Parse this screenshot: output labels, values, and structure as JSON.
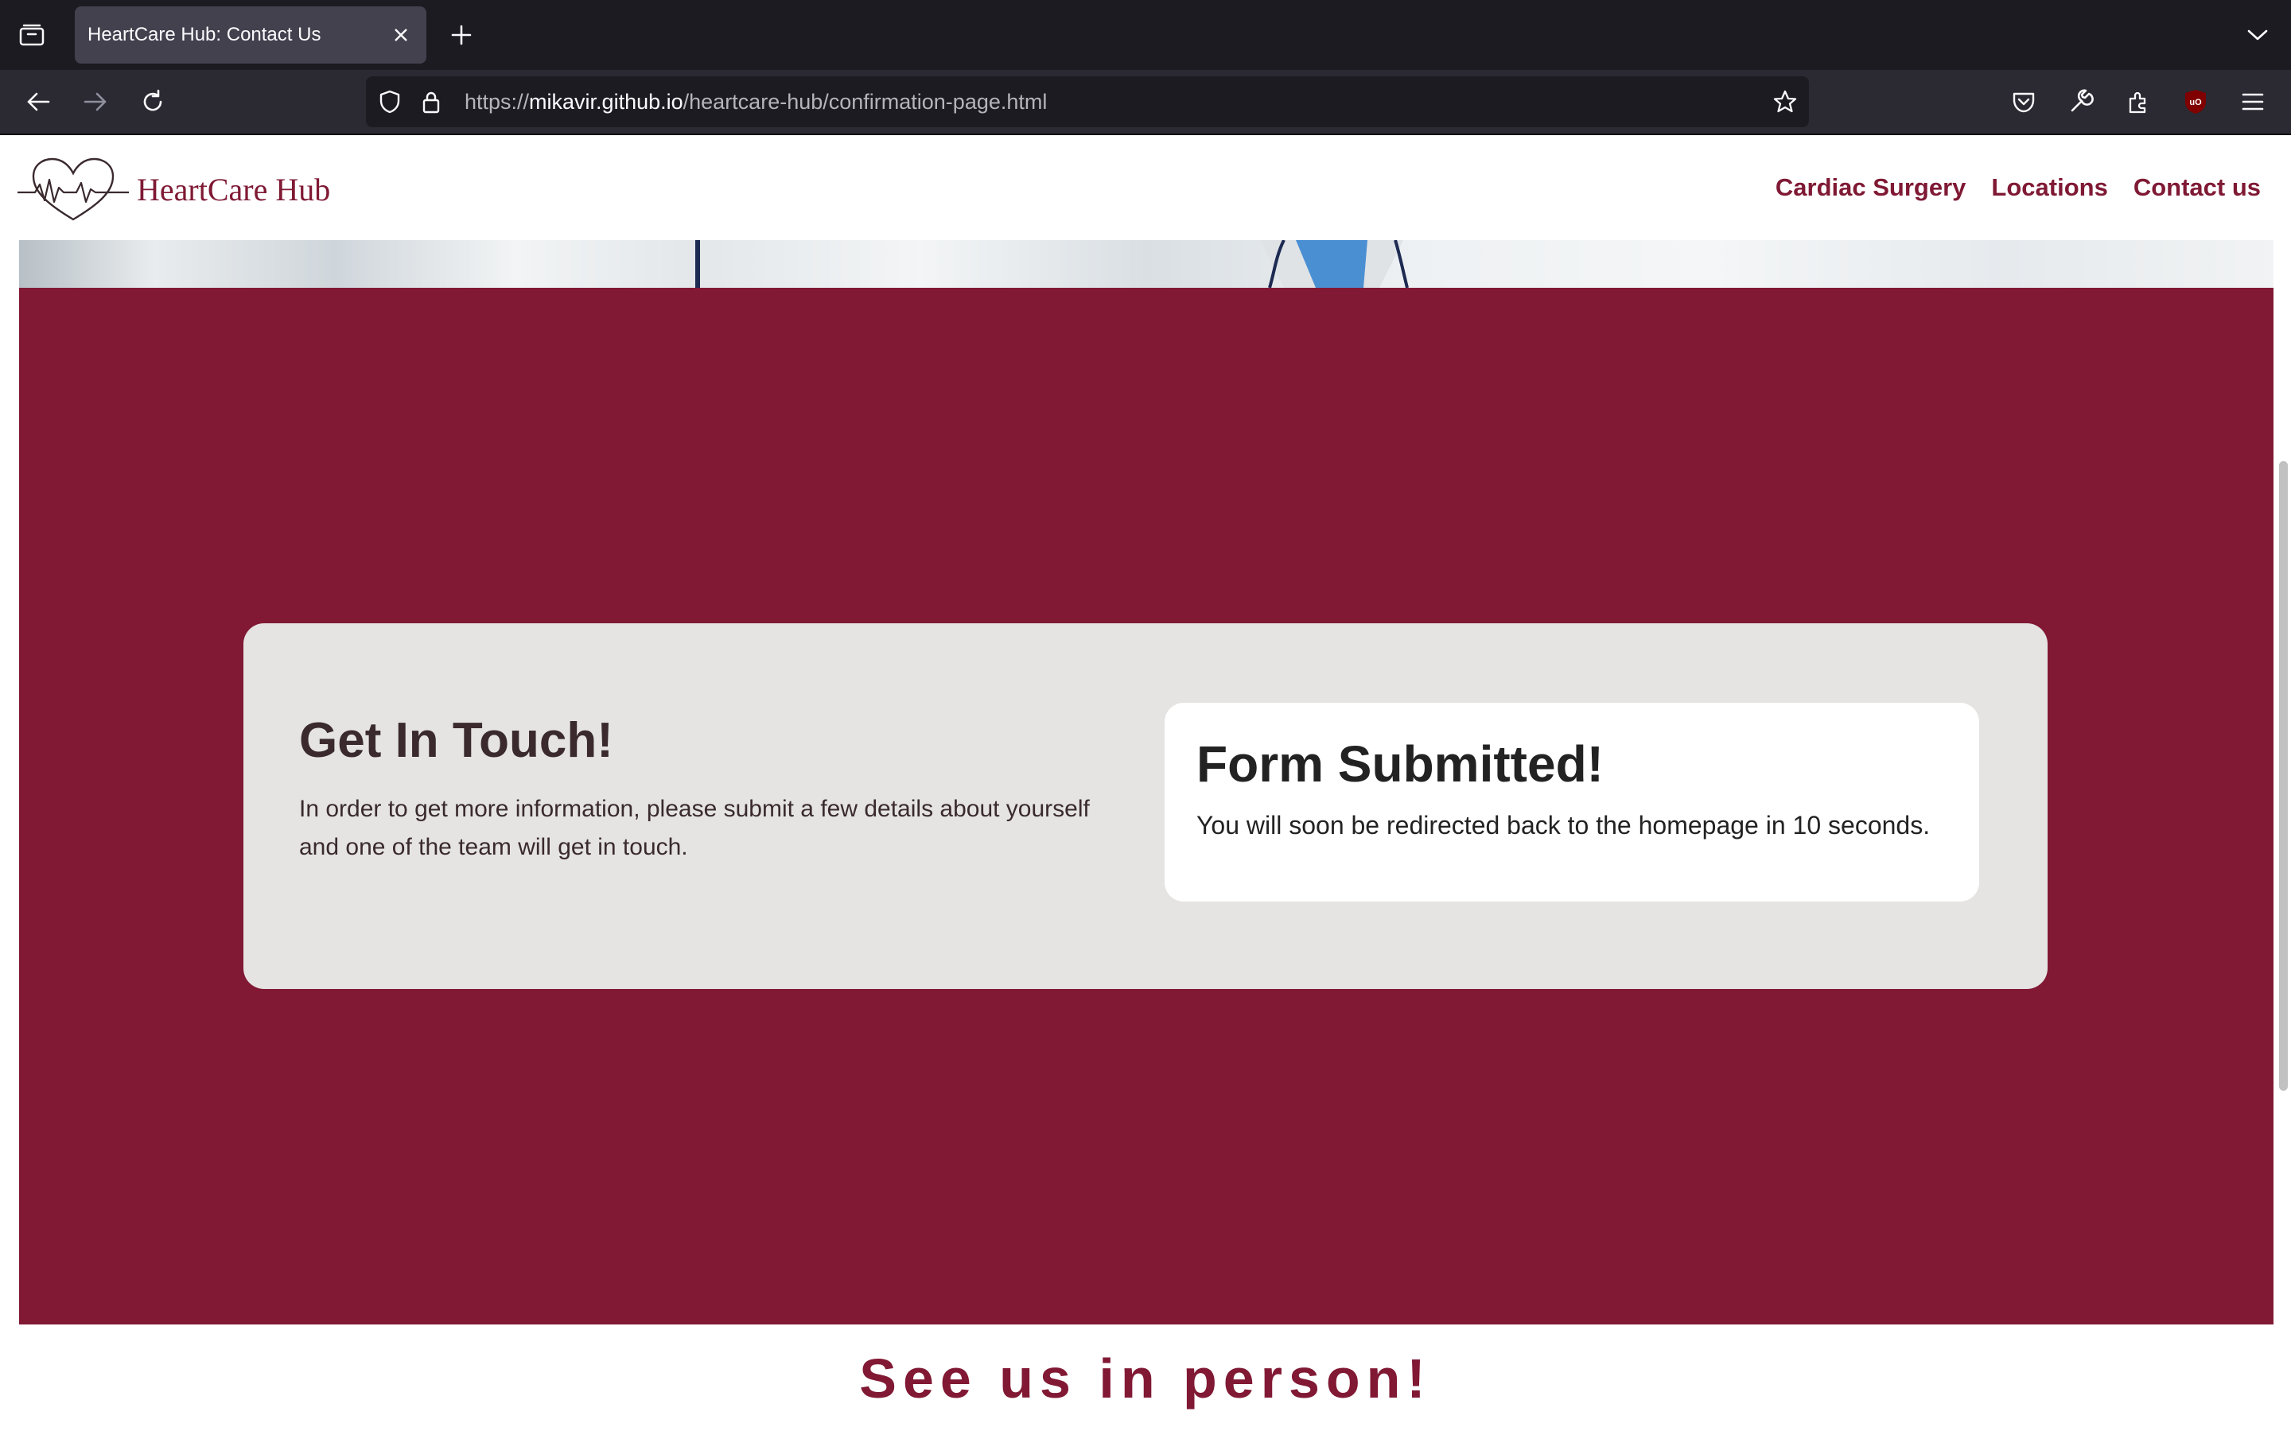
{
  "browser": {
    "tab_title": "HeartCare Hub: Contact Us",
    "url_prefix": "https://",
    "url_host": "mikavir.github.io",
    "url_path": "/heartcare-hub/confirmation-page.html"
  },
  "site": {
    "logo_text": "HeartCare Hub",
    "nav": [
      "Cardiac Surgery",
      "Locations",
      "Contact us"
    ],
    "brand_color": "#811934"
  },
  "contact": {
    "title": "Get In Touch!",
    "description": "In order to get more information, please submit a few details about yourself and one of the team will get in touch.",
    "confirmation_title": "Form Submitted!",
    "confirmation_message": "You will soon be redirected back to the homepage in 10 seconds."
  },
  "section": {
    "heading": "See us in person!"
  }
}
